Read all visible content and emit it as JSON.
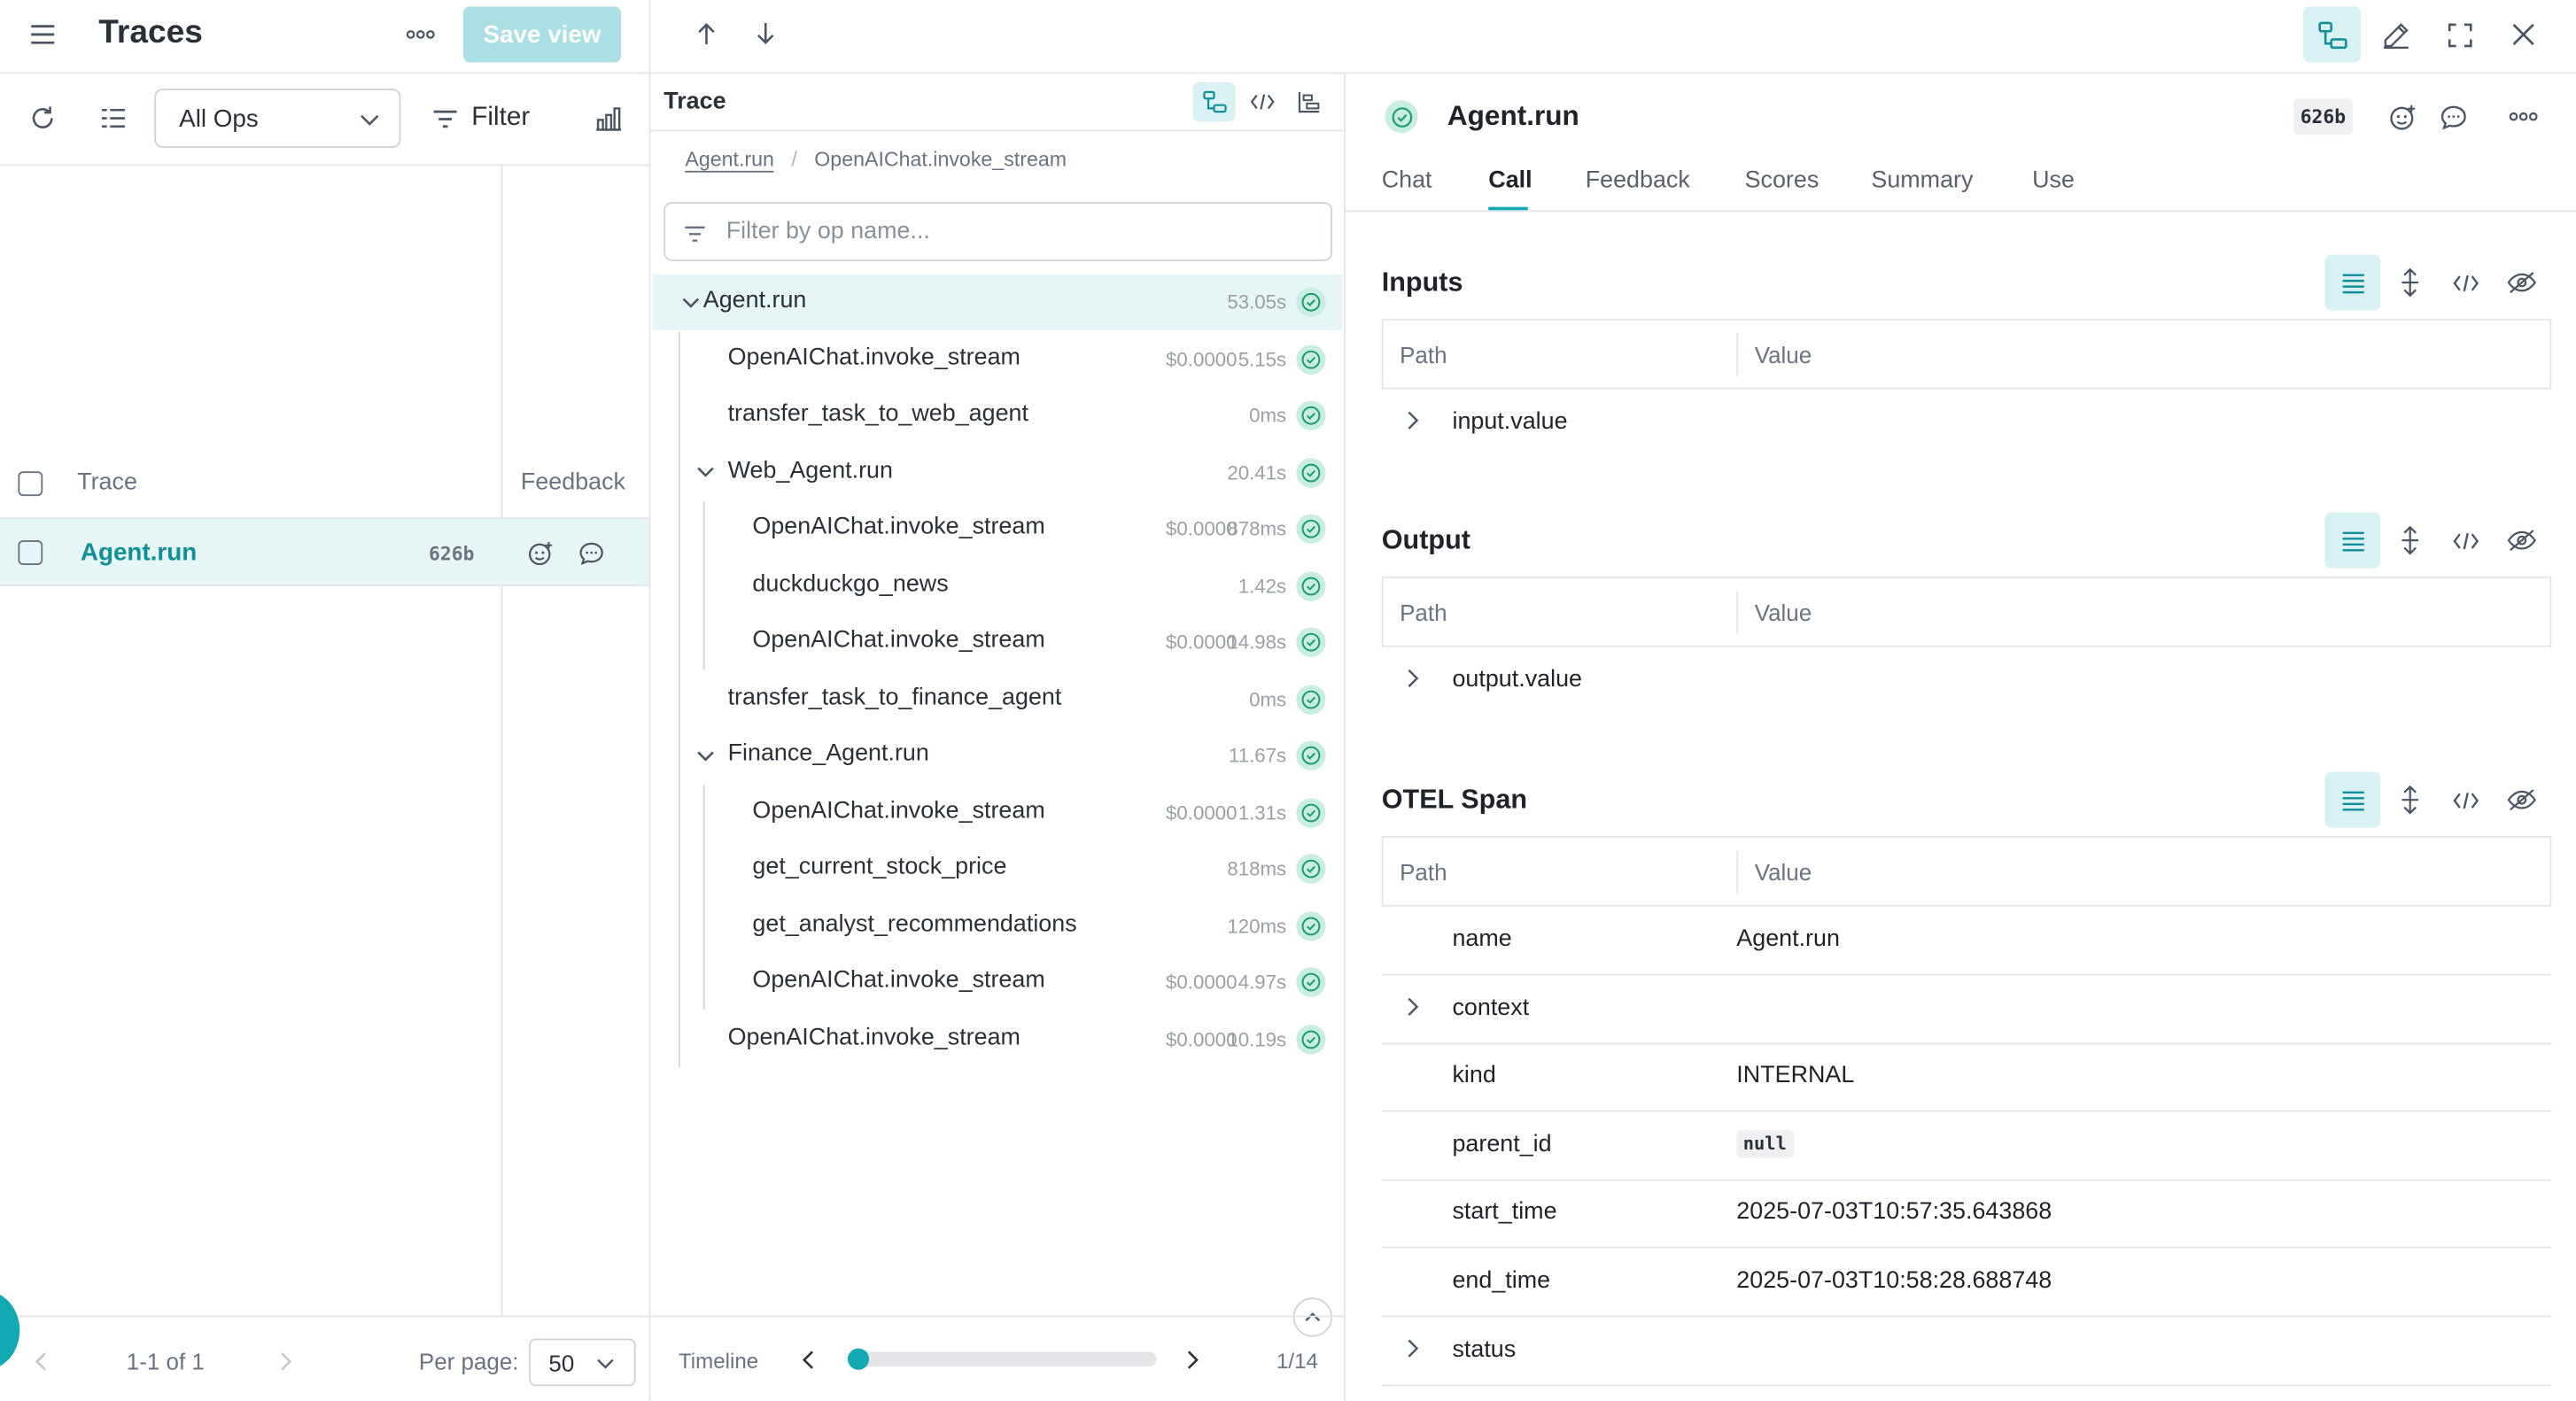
{
  "left": {
    "title": "Traces",
    "save_view": "Save view",
    "ops_select": "All Ops",
    "filter_label": "Filter",
    "col_trace": "Trace",
    "col_feedback": "Feedback",
    "row": {
      "name": "Agent.run",
      "size": "626b"
    },
    "pagination": {
      "range": "1-1 of 1",
      "per_page_label": "Per page:",
      "per_page_value": "50"
    }
  },
  "trace": {
    "title": "Trace",
    "breadcrumb": [
      "Agent.run",
      "/",
      "OpenAIChat.invoke_stream"
    ],
    "filter_placeholder": "Filter by op name...",
    "nodes": [
      {
        "name": "Agent.run",
        "cost": "",
        "duration": "53.05s"
      },
      {
        "name": "OpenAIChat.invoke_stream",
        "cost": "$0.0000",
        "duration": "5.15s"
      },
      {
        "name": "transfer_task_to_web_agent",
        "cost": "",
        "duration": "0ms"
      },
      {
        "name": "Web_Agent.run",
        "cost": "",
        "duration": "20.41s"
      },
      {
        "name": "OpenAIChat.invoke_stream",
        "cost": "$0.0000",
        "duration": "878ms"
      },
      {
        "name": "duckduckgo_news",
        "cost": "",
        "duration": "1.42s"
      },
      {
        "name": "OpenAIChat.invoke_stream",
        "cost": "$0.0000",
        "duration": "14.98s"
      },
      {
        "name": "transfer_task_to_finance_agent",
        "cost": "",
        "duration": "0ms"
      },
      {
        "name": "Finance_Agent.run",
        "cost": "",
        "duration": "11.67s"
      },
      {
        "name": "OpenAIChat.invoke_stream",
        "cost": "$0.0000",
        "duration": "1.31s"
      },
      {
        "name": "get_current_stock_price",
        "cost": "",
        "duration": "818ms"
      },
      {
        "name": "get_analyst_recommendations",
        "cost": "",
        "duration": "120ms"
      },
      {
        "name": "OpenAIChat.invoke_stream",
        "cost": "$0.0000",
        "duration": "4.97s"
      },
      {
        "name": "OpenAIChat.invoke_stream",
        "cost": "$0.0000",
        "duration": "10.19s"
      }
    ],
    "timeline_label": "Timeline",
    "timeline_position": "1/14"
  },
  "detail": {
    "title": "Agent.run",
    "size": "626b",
    "tabs": [
      "Chat",
      "Call",
      "Feedback",
      "Scores",
      "Summary",
      "Use"
    ],
    "active_tab": "Call",
    "path_label": "Path",
    "value_label": "Value",
    "inputs": {
      "title": "Inputs",
      "row": "input.value"
    },
    "output": {
      "title": "Output",
      "row": "output.value"
    },
    "otel": {
      "title": "OTEL Span",
      "rows": [
        {
          "key": "name",
          "value": "Agent.run"
        },
        {
          "key": "context",
          "value": ""
        },
        {
          "key": "kind",
          "value": "INTERNAL"
        },
        {
          "key": "parent_id",
          "value": "null"
        },
        {
          "key": "start_time",
          "value": "2025-07-03T10:57:35.643868"
        },
        {
          "key": "end_time",
          "value": "2025-07-03T10:58:28.688748"
        },
        {
          "key": "status",
          "value": ""
        }
      ]
    }
  },
  "colors": {
    "accent": "#13a9b3",
    "tint": "#d9f1f3",
    "ok_bg": "#c9ede0",
    "ok_fg": "#1f9e6e",
    "selected_row": "#e6f5f6"
  }
}
